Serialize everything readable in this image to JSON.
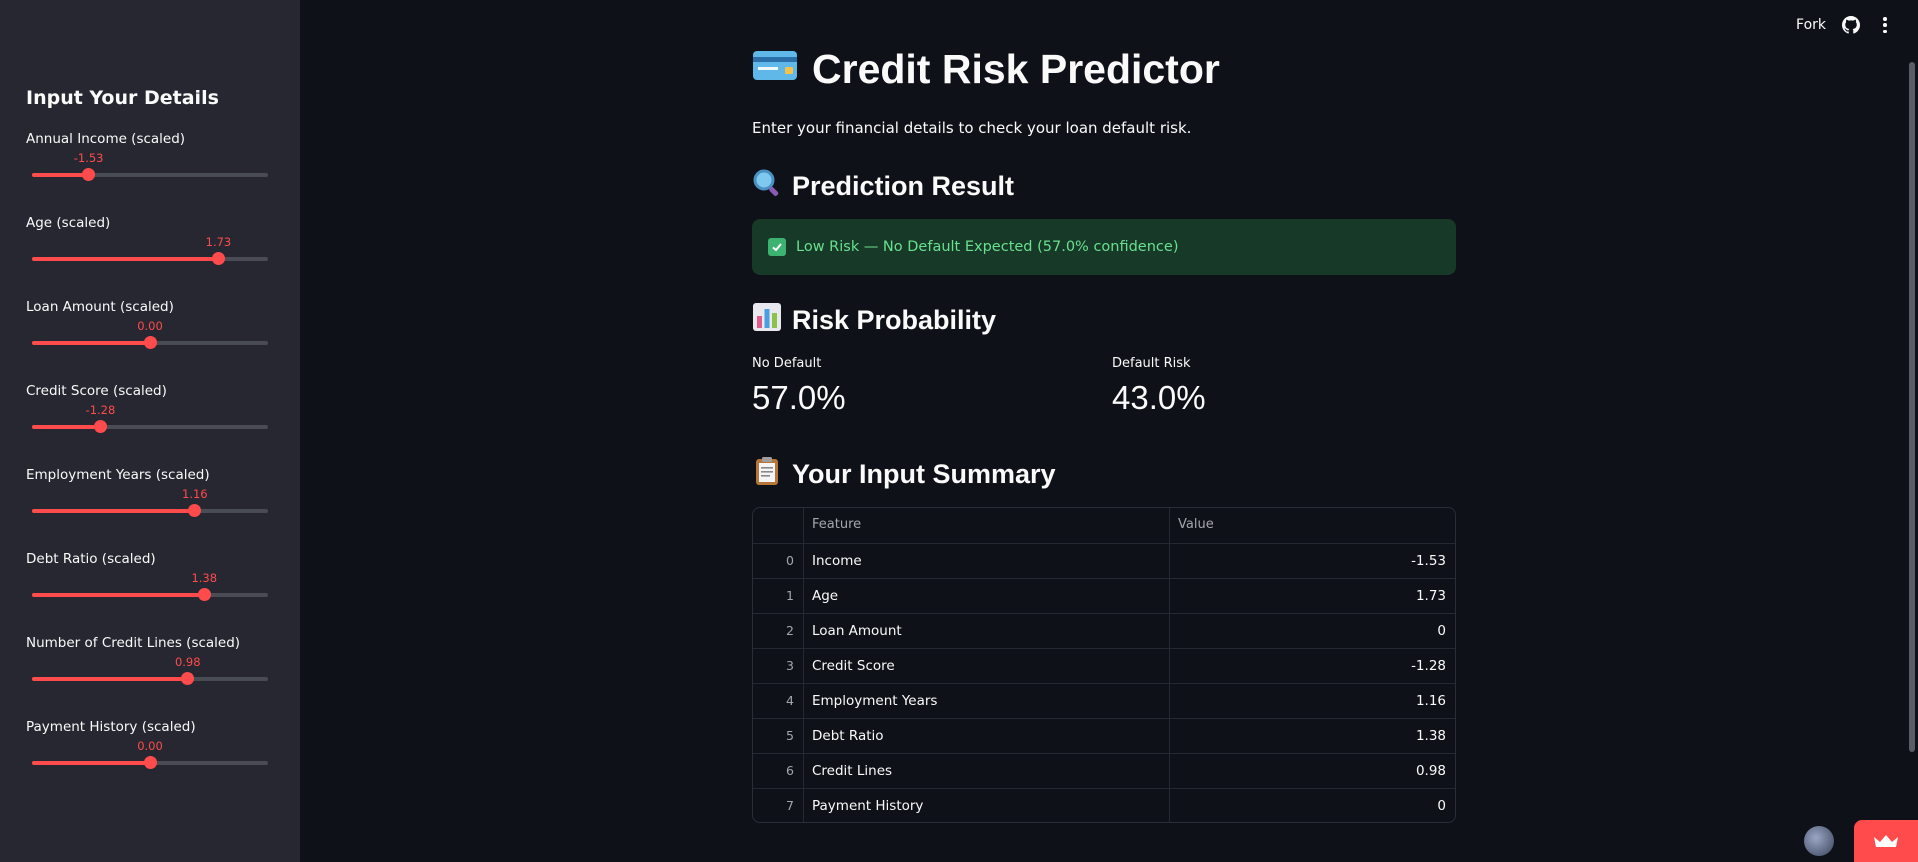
{
  "sidebar": {
    "title": "Input Your Details",
    "sliders": [
      {
        "label": "Annual Income (scaled)",
        "value": "-1.53",
        "fraction": 0.24
      },
      {
        "label": "Age (scaled)",
        "value": "1.73",
        "fraction": 0.79
      },
      {
        "label": "Loan Amount (scaled)",
        "value": "0.00",
        "fraction": 0.5
      },
      {
        "label": "Credit Score (scaled)",
        "value": "-1.28",
        "fraction": 0.29
      },
      {
        "label": "Employment Years (scaled)",
        "value": "1.16",
        "fraction": 0.69
      },
      {
        "label": "Debt Ratio (scaled)",
        "value": "1.38",
        "fraction": 0.73
      },
      {
        "label": "Number of Credit Lines (scaled)",
        "value": "0.98",
        "fraction": 0.66
      },
      {
        "label": "Payment History (scaled)",
        "value": "0.00",
        "fraction": 0.5
      }
    ]
  },
  "toolbar": {
    "fork_label": "Fork"
  },
  "main": {
    "title": "Credit Risk Predictor",
    "subtitle": "Enter your financial details to check your loan default risk.",
    "prediction_heading": "Prediction Result",
    "alert_text": "Low Risk — No Default Expected (57.0% confidence)",
    "probability_heading": "Risk Probability",
    "metrics": [
      {
        "label": "No Default",
        "value": "57.0%"
      },
      {
        "label": "Default Risk",
        "value": "43.0%"
      }
    ],
    "summary_heading": "Your Input Summary",
    "table": {
      "columns": [
        "Feature",
        "Value"
      ],
      "rows": [
        {
          "index": "0",
          "feature": "Income",
          "value": "-1.53"
        },
        {
          "index": "1",
          "feature": "Age",
          "value": "1.73"
        },
        {
          "index": "2",
          "feature": "Loan Amount",
          "value": "0"
        },
        {
          "index": "3",
          "feature": "Credit Score",
          "value": "-1.28"
        },
        {
          "index": "4",
          "feature": "Employment Years",
          "value": "1.16"
        },
        {
          "index": "5",
          "feature": "Debt Ratio",
          "value": "1.38"
        },
        {
          "index": "6",
          "feature": "Credit Lines",
          "value": "0.98"
        },
        {
          "index": "7",
          "feature": "Payment History",
          "value": "0"
        }
      ]
    }
  },
  "colors": {
    "accent": "#ff4b4b",
    "background": "#0e1117",
    "sidebar": "#262730",
    "success_bg": "#173928",
    "success_text": "#68e08d"
  }
}
